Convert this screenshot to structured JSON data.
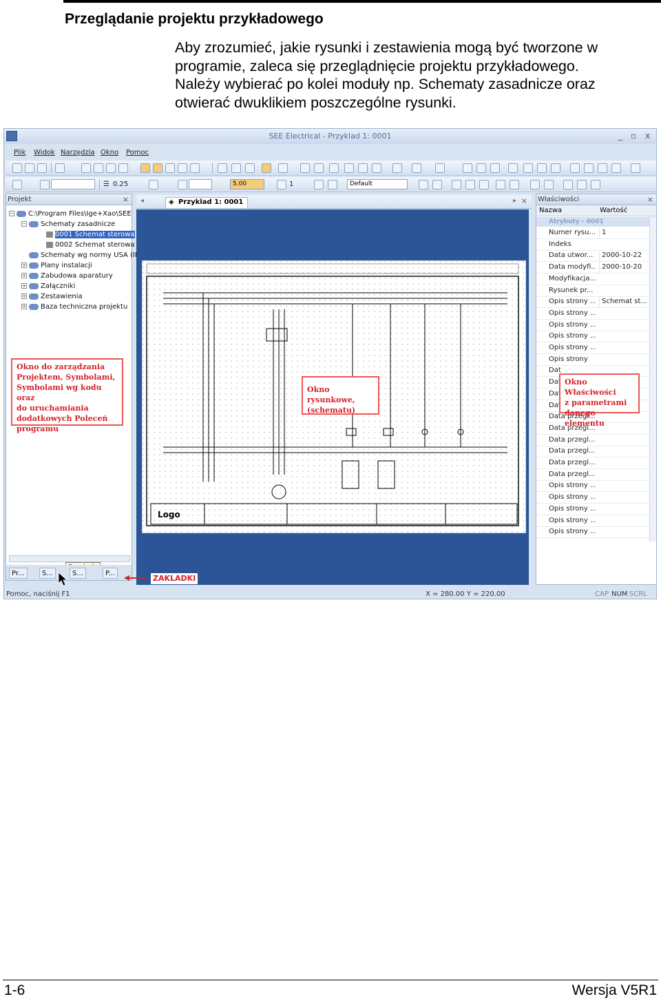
{
  "heading": "Przeglądanie projektu przykładowego",
  "intro_lines": [
    "Aby zrozumieć, jakie rysunki i zestawienia mogą być tworzone w",
    "programie, zaleca się przeglądnięcie projektu przykładowego.",
    "Należy wybierać po kolei moduły np. Schematy zasadnicze oraz",
    "otwierać dwuklikiem poszczególne rysunki."
  ],
  "app": {
    "title": "SEE Electrical - Przyklad 1: 0001",
    "window_controls": [
      "_",
      "▫",
      "x"
    ],
    "menu": [
      "Plik",
      "Widok",
      "Narzędzia",
      "Okno",
      "Pomoc"
    ],
    "toolbar": {
      "line_width": "0.25",
      "grid": "5.00",
      "layer": "1",
      "style": "Default"
    },
    "project_panel": {
      "title": "Projekt",
      "close": "×",
      "tree": [
        {
          "label": "C:\\Program Files\\Ige+Xao\\SEE",
          "level": 0,
          "kind": "root"
        },
        {
          "label": "Schematy zasadnicze",
          "level": 1,
          "kind": "folder"
        },
        {
          "label": "0001   Schemat sterowa",
          "level": 2,
          "kind": "doc",
          "selected": true
        },
        {
          "label": "0002   Schemat sterowa",
          "level": 2,
          "kind": "doc"
        },
        {
          "label": "Schematy wg normy USA (IE",
          "level": 1,
          "kind": "folder"
        },
        {
          "label": "Plany instalacji",
          "level": 1,
          "kind": "folder"
        },
        {
          "label": "Zabudowa aparatury",
          "level": 1,
          "kind": "folder"
        },
        {
          "label": "Załączniki",
          "level": 1,
          "kind": "folder"
        },
        {
          "label": "Zestawienia",
          "level": 1,
          "kind": "folder"
        },
        {
          "label": "Baza techniczna projektu",
          "level": 1,
          "kind": "folder"
        }
      ],
      "tabs": [
        "Pr...",
        "S...",
        "S...",
        "P..."
      ],
      "tooltip": "Symbole"
    },
    "drawing": {
      "tab_title": "Przyklad 1: 0001",
      "tab_label": "ZAKLADKI",
      "title_block_logo": "Logo"
    },
    "properties": {
      "title": "Właściwości",
      "close": "×",
      "col_name": "Nazwa",
      "col_value": "Wartość",
      "group": "Atrybuty - 0001",
      "rows": [
        {
          "name": "Numer rysu...",
          "value": "1"
        },
        {
          "name": "Indeks",
          "value": ""
        },
        {
          "name": "Data utwor...",
          "value": "2000-10-22"
        },
        {
          "name": "Data modyfi...",
          "value": "2000-10-20"
        },
        {
          "name": "Modyfikacja...",
          "value": ""
        },
        {
          "name": "Rysunek pr...",
          "value": ""
        },
        {
          "name": "Opis strony ...",
          "value": "Schemat st..."
        },
        {
          "name": "Opis strony ...",
          "value": ""
        },
        {
          "name": "Opis strony ...",
          "value": ""
        },
        {
          "name": "Opis strony ...",
          "value": ""
        },
        {
          "name": "Opis strony ...",
          "value": ""
        },
        {
          "name": "Opis strony",
          "value": ""
        },
        {
          "name": "Dat",
          "value": ""
        },
        {
          "name": "Dat",
          "value": ""
        },
        {
          "name": "Dat",
          "value": ""
        },
        {
          "name": "Dat",
          "value": ""
        },
        {
          "name": "Data przegl...",
          "value": ""
        },
        {
          "name": "Data przegl...",
          "value": ""
        },
        {
          "name": "Data przegl...",
          "value": ""
        },
        {
          "name": "Data przegl...",
          "value": ""
        },
        {
          "name": "Data przegl...",
          "value": ""
        },
        {
          "name": "Data przegl...",
          "value": ""
        },
        {
          "name": "Opis strony ...",
          "value": ""
        },
        {
          "name": "Opis strony ...",
          "value": ""
        },
        {
          "name": "Opis strony ...",
          "value": ""
        },
        {
          "name": "Opis strony ...",
          "value": ""
        },
        {
          "name": "Opis strony ...",
          "value": ""
        }
      ]
    },
    "status": {
      "help": "Pomoc, naciśnij F1",
      "coords": "X = 280.00  Y = 220.00",
      "indicators": [
        "CAP",
        "NUM",
        "SCRL"
      ]
    }
  },
  "callouts": {
    "project_window": [
      "Okno do zarządzania",
      "Projektem, Symbolami,",
      "Symbolami wg kodu oraz",
      "do uruchamiania",
      "dodatkowych Poleceń",
      "programu"
    ],
    "drawing_window": [
      "Okno rysunkowe,",
      "(schematu)"
    ],
    "properties_window": [
      "Okno Właściwości",
      "z parametrami",
      "danego elementu"
    ]
  },
  "footer": {
    "page": "1-6",
    "version": "Wersja V5R1"
  }
}
